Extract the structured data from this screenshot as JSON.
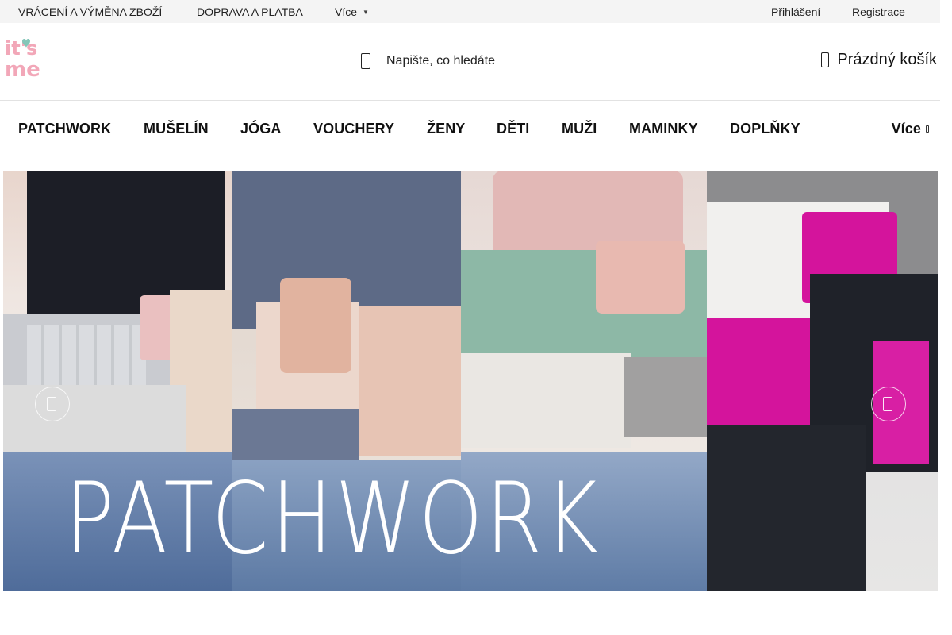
{
  "topbar": {
    "links": [
      "VRÁCENÍ A VÝMĚNA ZBOŽÍ",
      "DOPRAVA A PLATBA",
      "Více"
    ],
    "login": "Přihlášení",
    "register": "Registrace"
  },
  "header": {
    "logo_text": "it's me",
    "search_placeholder": "Napište, co hledáte",
    "cart_label": "Prázdný košík"
  },
  "nav": {
    "items": [
      "PATCHWORK",
      "MUŠELÍN",
      "JÓGA",
      "VOUCHERY",
      "ŽENY",
      "DĚTI",
      "MUŽI",
      "MAMINKY",
      "DOPLŇKY"
    ],
    "more": "Více"
  },
  "hero": {
    "title": "PATCHWORK"
  },
  "colors": {
    "logo_pink": "#f2a7b8",
    "logo_heart": "#84c6b8",
    "topbar_bg": "#f4f4f4",
    "magenta": "#d4149c",
    "mint": "#7fb4a4"
  },
  "icons": [
    "search-icon",
    "cart-icon",
    "chevron-down-icon",
    "chevron-left-icon",
    "chevron-right-icon"
  ]
}
